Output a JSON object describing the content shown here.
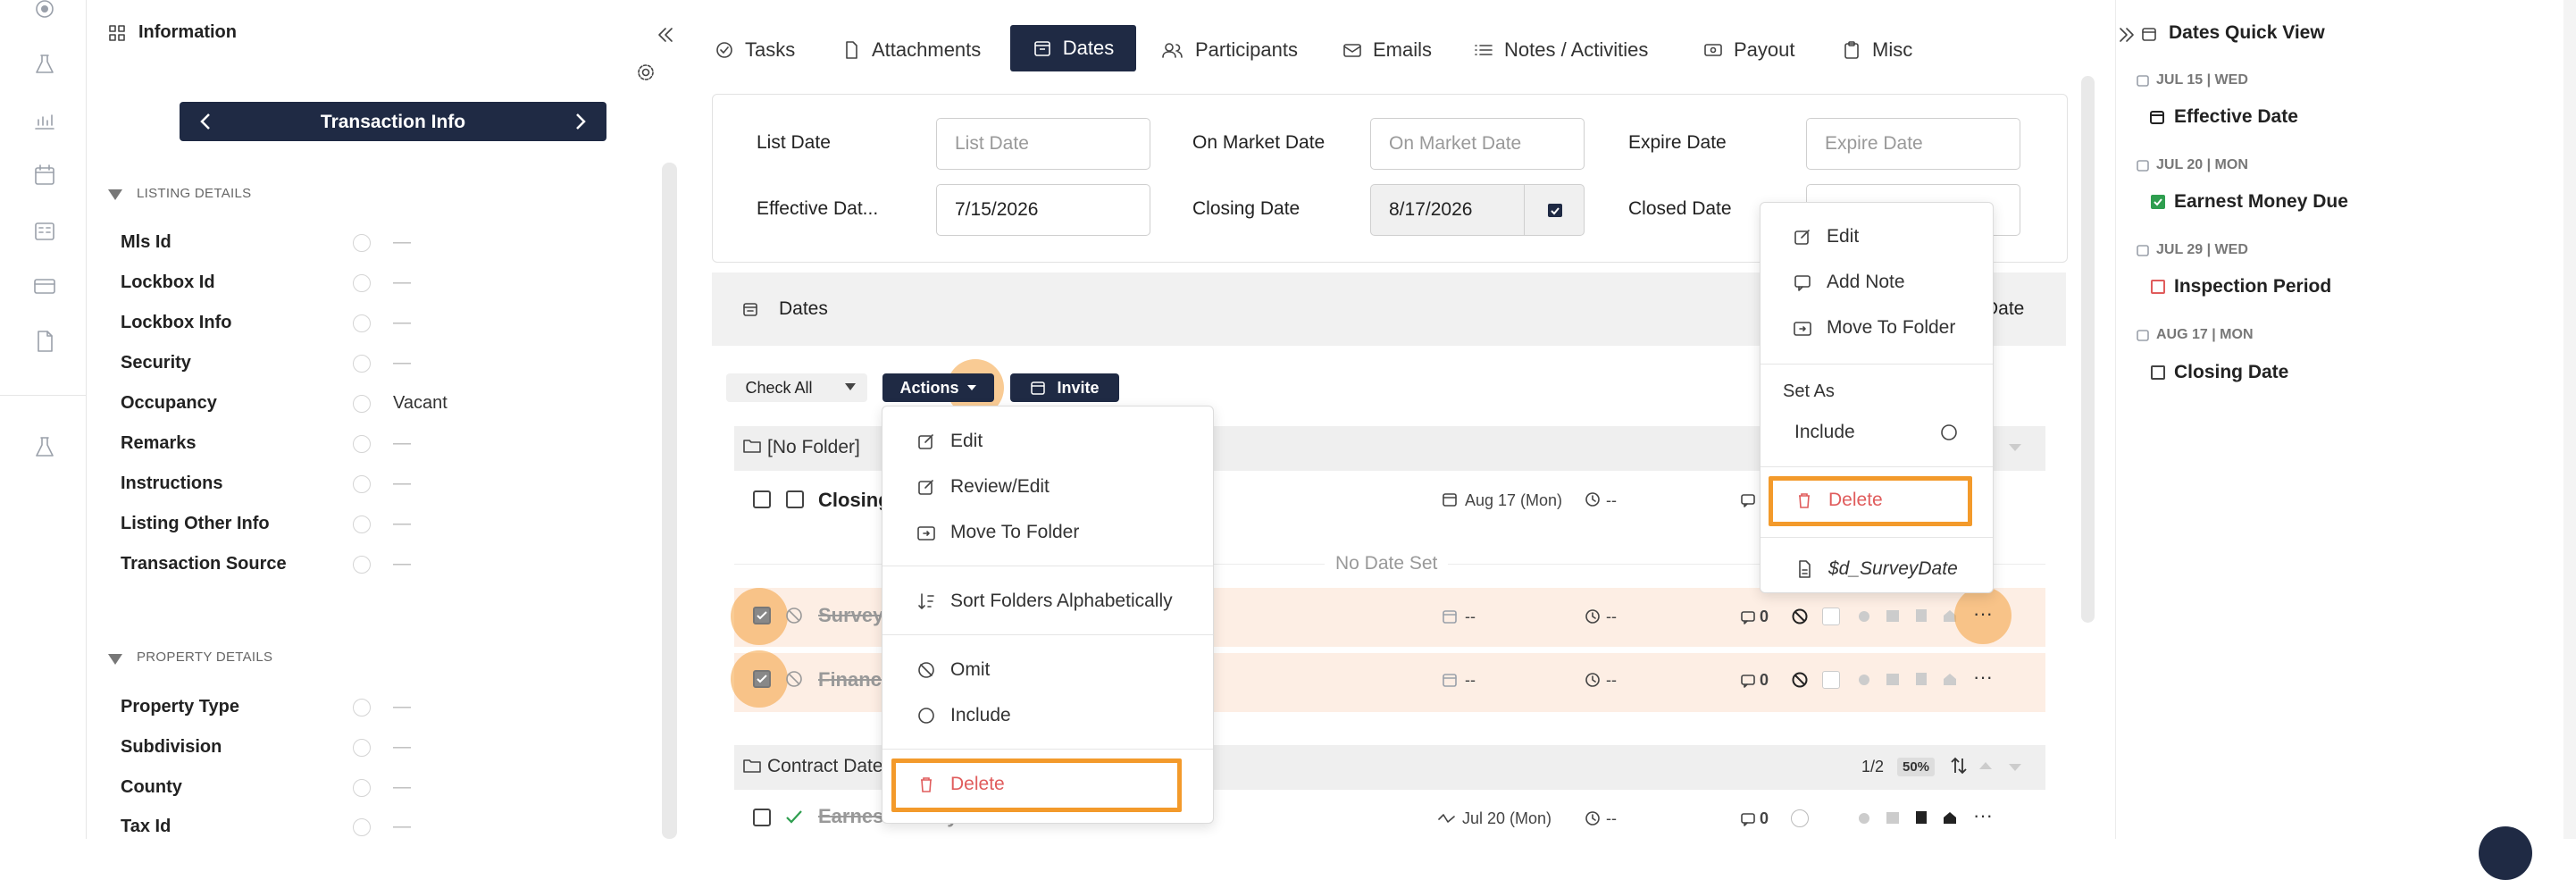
{
  "info_panel": {
    "title": "Information",
    "nav_label": "Transaction Info",
    "listing_section": "LISTING DETAILS",
    "listing_fields": [
      {
        "label": "Mls Id",
        "value": "—"
      },
      {
        "label": "Lockbox Id",
        "value": "—"
      },
      {
        "label": "Lockbox Info",
        "value": "—"
      },
      {
        "label": "Security",
        "value": "—"
      },
      {
        "label": "Occupancy",
        "value": "Vacant"
      },
      {
        "label": "Remarks",
        "value": "—"
      },
      {
        "label": "Instructions",
        "value": "—"
      },
      {
        "label": "Listing Other Info",
        "value": "—"
      },
      {
        "label": "Transaction Source",
        "value": "—"
      }
    ],
    "property_section": "PROPERTY DETAILS",
    "property_fields": [
      {
        "label": "Property Type",
        "value": "—"
      },
      {
        "label": "Subdivision",
        "value": "—"
      },
      {
        "label": "County",
        "value": "—"
      },
      {
        "label": "Tax Id",
        "value": "—"
      }
    ]
  },
  "tabs": [
    {
      "label": "Tasks",
      "icon": "check-circle-icon"
    },
    {
      "label": "Attachments",
      "icon": "file-icon"
    },
    {
      "label": "Dates",
      "icon": "calendar-icon",
      "active": true
    },
    {
      "label": "Participants",
      "icon": "users-icon"
    },
    {
      "label": "Emails",
      "icon": "mail-icon"
    },
    {
      "label": "Notes / Activities",
      "icon": "list-icon"
    },
    {
      "label": "Payout",
      "icon": "money-icon"
    },
    {
      "label": "Misc",
      "icon": "clipboard-icon"
    }
  ],
  "date_fields": {
    "list_date": {
      "label": "List Date",
      "placeholder": "List Date"
    },
    "on_market_date": {
      "label": "On Market Date",
      "placeholder": "On Market Date"
    },
    "expire_date": {
      "label": "Expire Date",
      "placeholder": "Expire Date"
    },
    "effective_date": {
      "label": "Effective Dat...",
      "value": "7/15/2026"
    },
    "closing_date": {
      "label": "Closing Date",
      "value": "8/17/2026"
    },
    "closed_date": {
      "label": "Closed Date"
    }
  },
  "dates_section": {
    "title": "Dates",
    "header_right": "Date",
    "check_all": "Check All",
    "actions": "Actions",
    "invite": "Invite",
    "no_folder": "[No Folder]",
    "no_date_set": "No Date Set",
    "contract_folder": "Contract Date",
    "contract_count": "1/2",
    "contract_percent": "50%",
    "rows": [
      {
        "name": "Closing",
        "date": "Aug 17 (Mon)",
        "time": "--"
      },
      {
        "name": "Survey",
        "date": "--",
        "time": "--",
        "comments": "0"
      },
      {
        "name": "Finance",
        "date": "--",
        "time": "--",
        "comments": "0"
      },
      {
        "name": "Earnest Money Due",
        "date": "Jul 20 (Mon)",
        "time": "--",
        "comments": "0"
      }
    ]
  },
  "actions_menu": {
    "items": [
      "Edit",
      "Review/Edit",
      "Move To Folder",
      "Sort Folders Alphabetically",
      "Omit",
      "Include",
      "Delete"
    ]
  },
  "row_menu": {
    "items": [
      "Edit",
      "Add Note",
      "Move To Folder"
    ],
    "set_as": "Set As",
    "include": "Include",
    "delete": "Delete",
    "template": "$d_SurveyDate"
  },
  "quick_view": {
    "title": "Dates Quick View",
    "items": [
      {
        "date": "JUL 15 | WED",
        "name": "Effective Date",
        "icon": "calendar-icon"
      },
      {
        "date": "JUL 20 | MON",
        "name": "Earnest Money Due",
        "icon": "checked-box-icon"
      },
      {
        "date": "JUL 29 | WED",
        "name": "Inspection Period",
        "icon": "red-box-icon"
      },
      {
        "date": "AUG 17 | MON",
        "name": "Closing Date",
        "icon": "box-icon"
      }
    ]
  },
  "colors": {
    "navy": "#1f2a44",
    "orange_highlight": "#f39a2b",
    "red": "#e05c5c",
    "green": "#2e9e4f"
  }
}
